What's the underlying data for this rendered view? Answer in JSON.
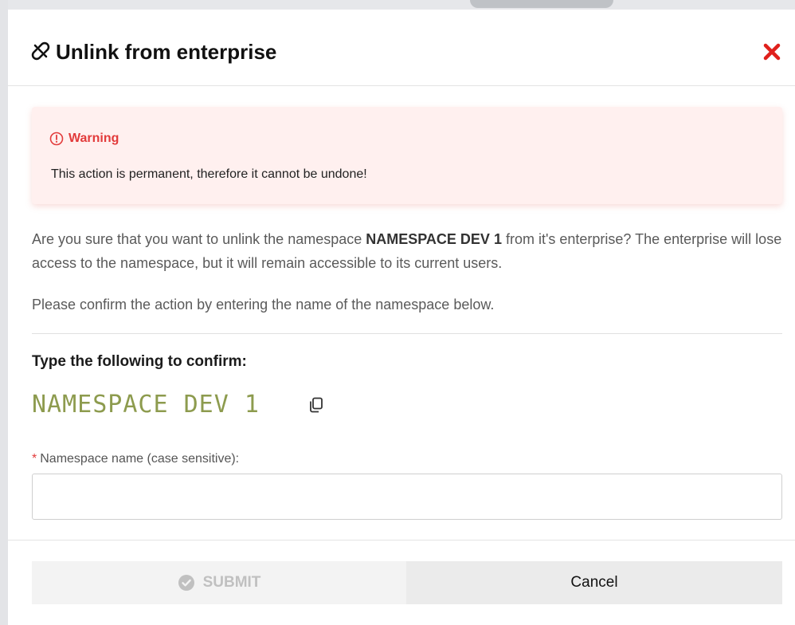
{
  "modal": {
    "title": "Unlink from enterprise",
    "title_icon": "unlink-icon",
    "close_icon": "close-icon"
  },
  "warning": {
    "icon": "exclamation-circle-icon",
    "title": "Warning",
    "message": "This action is permanent, therefore it cannot be undone!"
  },
  "body": {
    "question_prefix": "Are you sure that you want to unlink the namespace ",
    "namespace_name": "NAMESPACE DEV 1",
    "question_suffix": " from it's enterprise? The enterprise will lose access to the namespace, but it will remain accessible to its current users.",
    "instruction": "Please confirm the action by entering the name of the namespace below."
  },
  "confirm": {
    "label": "Type the following to confirm:",
    "target_text": "NAMESPACE DEV 1",
    "copy_icon": "copy-icon",
    "field_required_marker": "*",
    "field_label": "Namespace name (case sensitive):",
    "field_value": ""
  },
  "footer": {
    "submit_label": "SUBMIT",
    "submit_icon": "check-circle-icon",
    "cancel_label": "Cancel"
  },
  "colors": {
    "danger": "#e23b3b",
    "warning_bg": "#fff0ef",
    "target_text": "#8d9b4e"
  }
}
